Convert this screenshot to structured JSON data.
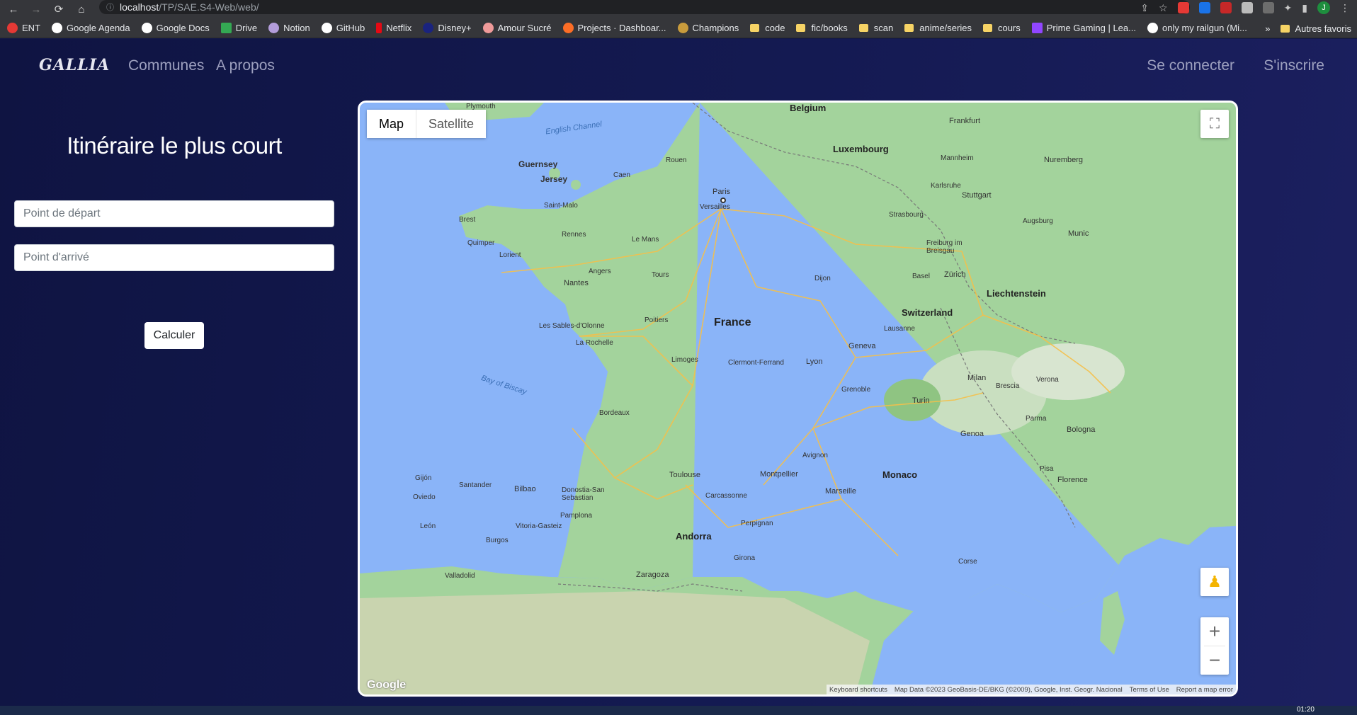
{
  "browser": {
    "url_host": "localhost",
    "url_path": "/TP/SAE.S4-Web/web/",
    "bookmarks": [
      "ENT",
      "Google Agenda",
      "Google Docs",
      "Drive",
      "Notion",
      "GitHub",
      "Netflix",
      "Disney+",
      "Amour Sucré",
      "Projects · Dashboar...",
      "Champions",
      "code",
      "fic/books",
      "scan",
      "anime/series",
      "cours",
      "Prime Gaming | Lea...",
      "only my railgun (Mi..."
    ],
    "other_bookmarks": "Autres favoris",
    "more": "»"
  },
  "nav": {
    "brand": "GALLIA",
    "communes": "Communes",
    "apropos": "A propos",
    "login": "Se connecter",
    "signup": "S'inscrire"
  },
  "form": {
    "title": "Itinéraire le plus court",
    "depart_placeholder": "Point de départ",
    "arrive_placeholder": "Point d'arrivé",
    "submit": "Calculer"
  },
  "map": {
    "type_map": "Map",
    "type_satellite": "Satellite",
    "logo": "Google",
    "attribution": [
      "Keyboard shortcuts",
      "Map Data ©2023 GeoBasis-DE/BKG (©2009), Google, Inst. Geogr. Nacional",
      "Terms of Use",
      "Report a map error"
    ],
    "labels": {
      "belgium": "Belgium",
      "luxembourg": "Luxembourg",
      "frankfurt": "Frankfurt",
      "nuremberg": "Nuremberg",
      "mannheim": "Mannheim",
      "karlsruhe": "Karlsruhe",
      "stuttgart": "Stuttgart",
      "strasbourg": "Strasbourg",
      "augsburg": "Augsburg",
      "munich": "Munic",
      "freiburg": "Freiburg im Breisgau",
      "basel": "Basel",
      "zurich": "Zürich",
      "liechtenstein": "Liechtenstein",
      "switzerland": "Switzerland",
      "lausanne": "Lausanne",
      "geneva": "Geneva",
      "milan": "Milan",
      "brescia": "Brescia",
      "verona": "Verona",
      "turin": "Turin",
      "parma": "Parma",
      "bologna": "Bologna",
      "genoa": "Genoa",
      "monaco": "Monaco",
      "pisa": "Pisa",
      "florence": "Florence",
      "corse": "Corse",
      "plymouth": "Plymouth",
      "channel": "English Channel",
      "guernsey": "Guernsey",
      "jersey": "Jersey",
      "caen": "Caen",
      "rouen": "Rouen",
      "paris": "Paris",
      "versailles": "Versailles",
      "saintmalo": "Saint-Malo",
      "brest": "Brest",
      "rennes": "Rennes",
      "quimper": "Quimper",
      "lorient": "Lorient",
      "lemans": "Le Mans",
      "angers": "Angers",
      "tours": "Tours",
      "nantes": "Nantes",
      "dijon": "Dijon",
      "france": "France",
      "poitiers": "Poitiers",
      "sables": "Les Sables-d'Olonne",
      "larochelle": "La Rochelle",
      "limoges": "Limoges",
      "clermont": "Clermont-Ferrand",
      "lyon": "Lyon",
      "grenoble": "Grenoble",
      "biscay": "Bay of Biscay",
      "bordeaux": "Bordeaux",
      "avignon": "Avignon",
      "toulouse": "Toulouse",
      "montpellier": "Montpellier",
      "marseille": "Marseille",
      "carcassonne": "Carcassonne",
      "perpignan": "Perpignan",
      "andorra": "Andorra",
      "girona": "Girona",
      "gijon": "Gijón",
      "oviedo": "Oviedo",
      "santander": "Santander",
      "bilbao": "Bilbao",
      "donostia": "Donostia-San Sebastian",
      "leon": "León",
      "vitoria": "Vitoria-Gasteiz",
      "pamplona": "Pamplona",
      "burgos": "Burgos",
      "valladolid": "Valladolid",
      "zaragoza": "Zaragoza"
    }
  },
  "taskbar": {
    "clock": "01:20"
  }
}
